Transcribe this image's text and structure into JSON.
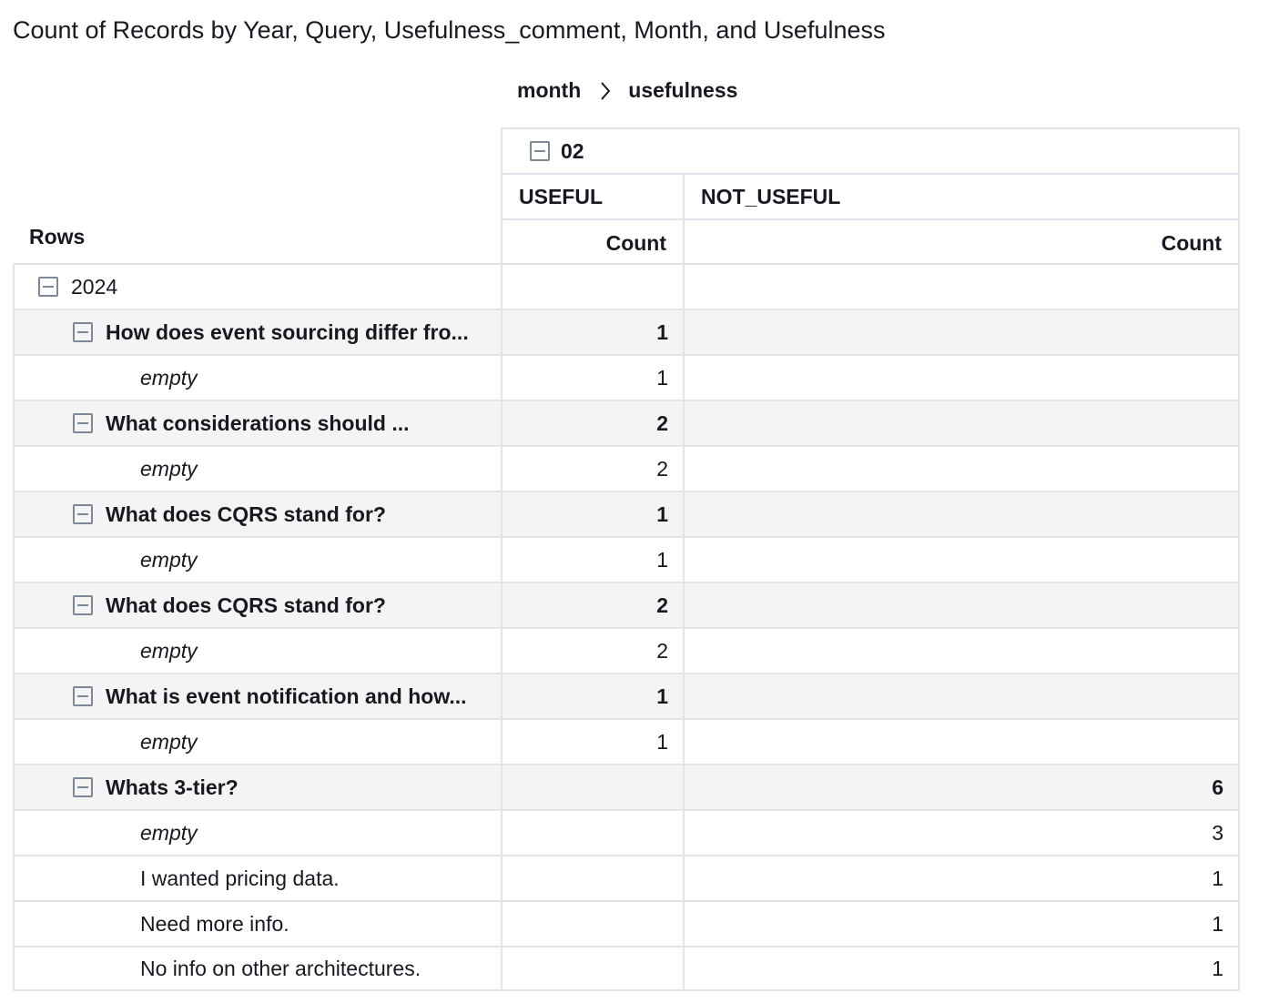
{
  "title": "Count of Records by Year, Query, Usefulness_comment, Month, and Usefulness",
  "breadcrumb": {
    "first": "month",
    "second": "usefulness"
  },
  "rows_label": "Rows",
  "columns": {
    "month": "02",
    "groups": [
      "USEFUL",
      "NOT_USEFUL"
    ],
    "measure": "Count"
  },
  "rows": [
    {
      "label": "2024",
      "level": 0,
      "useful": "",
      "not_useful": ""
    },
    {
      "label": "How does event sourcing differ fro...",
      "level": 1,
      "useful": "1",
      "not_useful": ""
    },
    {
      "label": "empty",
      "level": 2,
      "italic": true,
      "useful": "1",
      "not_useful": ""
    },
    {
      "label": "What considerations should ...",
      "level": 1,
      "useful": "2",
      "not_useful": ""
    },
    {
      "label": "empty",
      "level": 2,
      "italic": true,
      "useful": "2",
      "not_useful": ""
    },
    {
      "label": "What does CQRS stand for?",
      "level": 1,
      "useful": "1",
      "not_useful": ""
    },
    {
      "label": "empty",
      "level": 2,
      "italic": true,
      "useful": "1",
      "not_useful": ""
    },
    {
      "label": "What does CQRS stand for?",
      "level": 1,
      "useful": "2",
      "not_useful": ""
    },
    {
      "label": "empty",
      "level": 2,
      "italic": true,
      "useful": "2",
      "not_useful": ""
    },
    {
      "label": "What is event notification and how...",
      "level": 1,
      "useful": "1",
      "not_useful": ""
    },
    {
      "label": "empty",
      "level": 2,
      "italic": true,
      "useful": "1",
      "not_useful": ""
    },
    {
      "label": "Whats 3-tier?",
      "level": 1,
      "useful": "",
      "not_useful": "6"
    },
    {
      "label": "empty",
      "level": 2,
      "italic": true,
      "useful": "",
      "not_useful": "3"
    },
    {
      "label": "I wanted pricing data.",
      "level": 2,
      "useful": "",
      "not_useful": "1"
    },
    {
      "label": "Need more info.",
      "level": 2,
      "useful": "",
      "not_useful": "1"
    },
    {
      "label": "No info on other architectures.",
      "level": 2,
      "useful": "",
      "not_useful": "1"
    }
  ]
}
